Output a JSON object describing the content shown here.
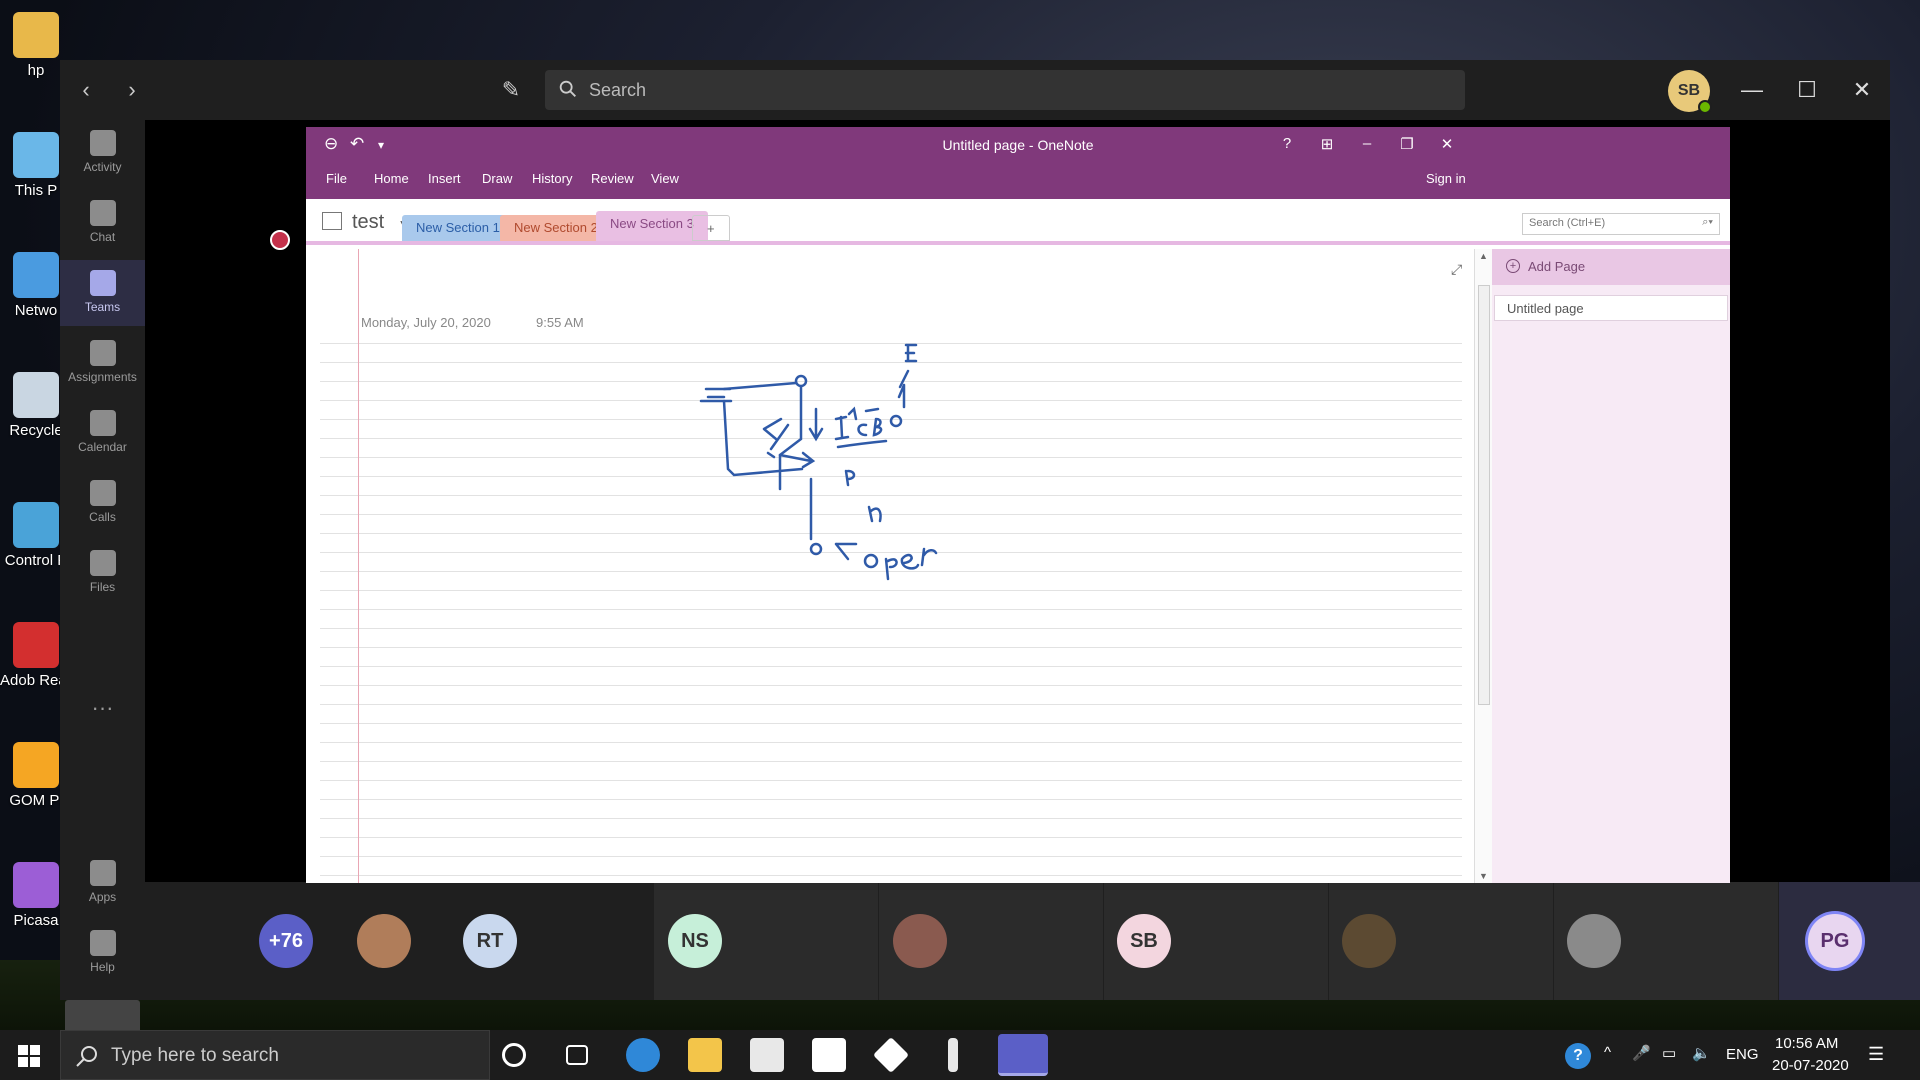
{
  "desktop": {
    "icons": [
      {
        "label": "hp",
        "name": "desktop-icon-hp",
        "color": "#e8b84a"
      },
      {
        "label": "This P",
        "name": "desktop-icon-this-pc",
        "color": "#6ab7e8"
      },
      {
        "label": "Netwo",
        "name": "desktop-icon-network",
        "color": "#4a9be0"
      },
      {
        "label": "Recycle",
        "name": "desktop-icon-recycle-bin",
        "color": "#c9d6e2"
      },
      {
        "label": "Control P",
        "name": "desktop-icon-control-panel",
        "color": "#4aa3d8"
      },
      {
        "label": "Adob Reader",
        "name": "desktop-icon-adobe-reader",
        "color": "#d32f2f"
      },
      {
        "label": "GOM Pl",
        "name": "desktop-icon-gom-player",
        "color": "#f5a623"
      },
      {
        "label": "Picasa",
        "name": "desktop-icon-picasa",
        "color": "#9c5ed6"
      }
    ]
  },
  "teams": {
    "search_placeholder": "Search",
    "user_initials": "SB",
    "rail": [
      {
        "label": "Activity",
        "name": "rail-activity"
      },
      {
        "label": "Chat",
        "name": "rail-chat"
      },
      {
        "label": "Teams",
        "name": "rail-teams",
        "active": true
      },
      {
        "label": "Assignments",
        "name": "rail-assignments"
      },
      {
        "label": "Calendar",
        "name": "rail-calendar"
      },
      {
        "label": "Calls",
        "name": "rail-calls"
      },
      {
        "label": "Files",
        "name": "rail-files"
      }
    ],
    "rail_bottom": [
      {
        "label": "Apps",
        "name": "rail-apps"
      },
      {
        "label": "Help",
        "name": "rail-help"
      }
    ],
    "more_label": "···"
  },
  "onenote": {
    "window_title": "Untitled page - OneNote",
    "menu": [
      "File",
      "Home",
      "Insert",
      "Draw",
      "History",
      "Review",
      "View"
    ],
    "sign_in": "Sign in",
    "help": "?",
    "notebook": "test",
    "sections": [
      {
        "label": "New Section 1",
        "color": "#a9c9ec",
        "text": "#2b5ea7"
      },
      {
        "label": "New Section 2",
        "color": "#f4b7a7",
        "text": "#b04a2e"
      },
      {
        "label": "New Section 3",
        "color": "#e9bfe3",
        "text": "#8a4a84",
        "active": true
      }
    ],
    "add_section": "+",
    "search_placeholder": "Search (Ctrl+E)",
    "page_date": "Monday, July 20, 2020",
    "page_time": "9:55 AM",
    "add_page": "Add Page",
    "pages": [
      "Untitled page"
    ]
  },
  "participants": [
    {
      "label": "+76",
      "bg": "#5b5fc7",
      "fg": "#ffffff"
    },
    {
      "label": "",
      "bg": "#b07d5a",
      "fg": "#ffffff",
      "photo": true
    },
    {
      "label": "RT",
      "bg": "#c9d8ee",
      "fg": "#333333"
    },
    {
      "label": "NS",
      "bg": "#c6efd9",
      "fg": "#333333"
    },
    {
      "label": "",
      "bg": "#8a5a4f",
      "fg": "#ffffff",
      "photo": true
    },
    {
      "label": "SB",
      "bg": "#f3d6df",
      "fg": "#333333"
    },
    {
      "label": "",
      "bg": "#5c4a32",
      "fg": "#ffffff",
      "photo": true
    },
    {
      "label": "",
      "bg": "#8a8a8a",
      "fg": "#ffffff",
      "generic": true
    },
    {
      "label": "PG",
      "bg": "#e8d6f0",
      "fg": "#5a2f6e",
      "speaking": true
    }
  ],
  "taskbar": {
    "search_placeholder": "Type here to search",
    "language": "ENG",
    "time": "10:56 AM",
    "date": "20-07-2020"
  }
}
